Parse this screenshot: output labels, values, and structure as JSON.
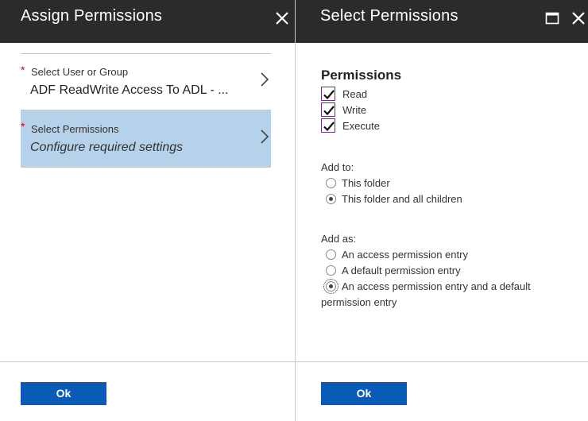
{
  "left_panel": {
    "title": "Assign Permissions",
    "user_field": {
      "required": "*",
      "label": "Select User or Group",
      "value": "ADF ReadWrite Access To ADL - ..."
    },
    "perm_field": {
      "required": "*",
      "label": "Select Permissions",
      "value": "Configure required settings"
    },
    "ok_label": "Ok"
  },
  "right_panel": {
    "title": "Select Permissions",
    "permissions_heading": "Permissions",
    "permissions": [
      {
        "label": "Read",
        "checked": true
      },
      {
        "label": "Write",
        "checked": true
      },
      {
        "label": "Execute",
        "checked": true
      }
    ],
    "add_to": {
      "label": "Add to:",
      "options": [
        {
          "label": "This folder",
          "selected": false
        },
        {
          "label": "This folder and all children",
          "selected": true
        }
      ]
    },
    "add_as": {
      "label": "Add as:",
      "options": [
        {
          "label": "An access permission entry",
          "selected": false
        },
        {
          "label": "A default permission entry",
          "selected": false
        },
        {
          "label": "An access permission entry and a default",
          "selected": true
        }
      ],
      "wrapped_continuation": "permission entry"
    },
    "ok_label": "Ok"
  },
  "icons": {
    "close": "close-icon",
    "maximize": "maximize-icon",
    "chevron": "chevron-right-icon",
    "check": "check-icon"
  },
  "colors": {
    "titlebar": "#2b2b2b",
    "selected_row": "#b5d2ea",
    "ok_button": "#0a5ab8",
    "required": "#d0021b",
    "checkbox_border": "#6b2d8a"
  }
}
